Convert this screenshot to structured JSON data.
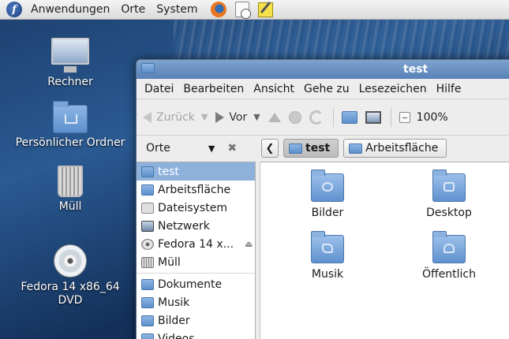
{
  "top_panel": {
    "menus": [
      "Anwendungen",
      "Orte",
      "System"
    ],
    "launchers": [
      "firefox-icon",
      "clock-document-icon",
      "notepad-icon"
    ]
  },
  "desktop_icons": [
    {
      "label": "Rechner",
      "icon": "computer-icon"
    },
    {
      "label": "Persönlicher Ordner",
      "icon": "home-folder-icon"
    },
    {
      "label": "Müll",
      "icon": "trash-icon"
    },
    {
      "label": "Fedora 14 x86_64 DVD",
      "icon": "dvd-icon"
    }
  ],
  "window": {
    "title": "test",
    "menubar": [
      "Datei",
      "Bearbeiten",
      "Ansicht",
      "Gehe zu",
      "Lesezeichen",
      "Hilfe"
    ],
    "toolbar": {
      "back_label": "Zurück",
      "forward_label": "Vor",
      "zoom_label": "100%"
    },
    "location": {
      "places_label": "Orte",
      "crumbs": [
        "test",
        "Arbeitsfläche"
      ]
    },
    "sidebar": {
      "items": [
        {
          "label": "test",
          "icon": "home-folder-icon",
          "selected": true
        },
        {
          "label": "Arbeitsfläche",
          "icon": "desktop-folder-icon"
        },
        {
          "label": "Dateisystem",
          "icon": "filesystem-icon"
        },
        {
          "label": "Netzwerk",
          "icon": "network-icon"
        },
        {
          "label": "Fedora 14 x...",
          "icon": "dvd-icon",
          "eject": true
        },
        {
          "label": "Müll",
          "icon": "trash-icon"
        }
      ],
      "bookmarks": [
        {
          "label": "Dokumente",
          "icon": "folder-icon"
        },
        {
          "label": "Musik",
          "icon": "folder-icon"
        },
        {
          "label": "Bilder",
          "icon": "folder-icon"
        },
        {
          "label": "Videos",
          "icon": "folder-icon"
        }
      ]
    },
    "files": [
      {
        "label": "Bilder",
        "icon": "pictures-folder-icon"
      },
      {
        "label": "Desktop",
        "icon": "desktop-folder-icon"
      },
      {
        "label": "Musik",
        "icon": "music-folder-icon"
      },
      {
        "label": "Öffentlich",
        "icon": "public-folder-icon"
      }
    ]
  },
  "colors": {
    "accent": "#5881b8",
    "selection": "#8eb1dc",
    "folder": "#5c8fcb"
  }
}
